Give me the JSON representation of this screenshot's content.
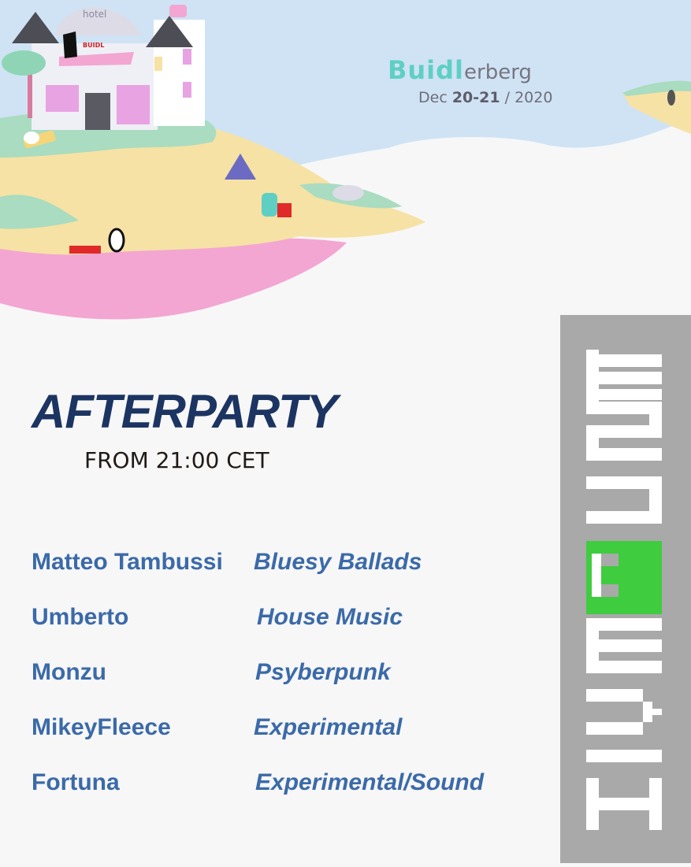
{
  "event": {
    "brand_part1": "Buidl",
    "brand_part2": "erberg",
    "date_prefix": "Dec ",
    "date_days": "20-21",
    "date_year": " / 2020",
    "hotel_sign": "hotel",
    "banner_text": "BUIDL"
  },
  "afterparty": {
    "title": "AFTERPARTY",
    "time": "FROM 21:00 CET"
  },
  "lineup": [
    {
      "artist": "Matteo Tambussi",
      "genre": "Bluesy Ballads"
    },
    {
      "artist": "Umberto",
      "genre": "House Music"
    },
    {
      "artist": "Monzu",
      "genre": "Psyberpunk"
    },
    {
      "artist": "MikeyFleece",
      "genre": "Experimental"
    },
    {
      "artist": "Fortuna",
      "genre": "Experimental/Sound"
    }
  ],
  "sponsor": {
    "logo_text": "HIVEMUSE",
    "colors": {
      "panel": "#a9a9a9",
      "accent": "#3fcc3f",
      "letters": "#ffffff"
    }
  },
  "colors": {
    "title": "#1c3461",
    "lineup": "#3b6aa8",
    "brand_teal": "#5fcfc4",
    "sky": "#cfe3f5",
    "island_pink": "#f3a6d2",
    "island_sand": "#f6e2a4",
    "grass": "#a9dcc0"
  }
}
